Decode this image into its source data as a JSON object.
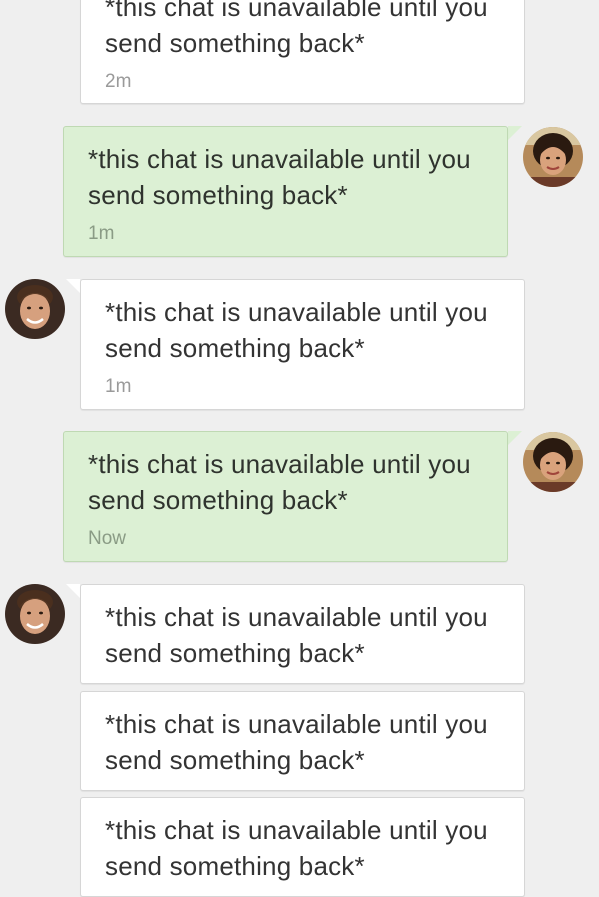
{
  "messages": [
    {
      "direction": "incoming",
      "text": "*this chat is unavailable until you send something back*",
      "time": "2m"
    },
    {
      "direction": "outgoing",
      "text": "*this chat is unavailable until you send something back*",
      "time": "1m"
    },
    {
      "direction": "incoming",
      "text": "*this chat is unavailable until you send something back*",
      "time": "1m"
    },
    {
      "direction": "outgoing",
      "text": "*this chat is unavailable until you send something back*",
      "time": "Now"
    },
    {
      "direction": "incoming",
      "text": "*this chat is unavailable until you send something back*",
      "time": ""
    },
    {
      "direction": "incoming",
      "text": "*this chat is unavailable until you send something back*",
      "time": ""
    },
    {
      "direction": "incoming",
      "text": "*this chat is unavailable until you send something back*",
      "time": ""
    }
  ],
  "avatars": {
    "incoming": "male-contact-avatar",
    "outgoing": "female-user-avatar"
  },
  "colors": {
    "background": "#efefef",
    "incoming_bubble": "#ffffff",
    "outgoing_bubble": "#dcf0d4",
    "timestamp": "#9a9a9a"
  }
}
